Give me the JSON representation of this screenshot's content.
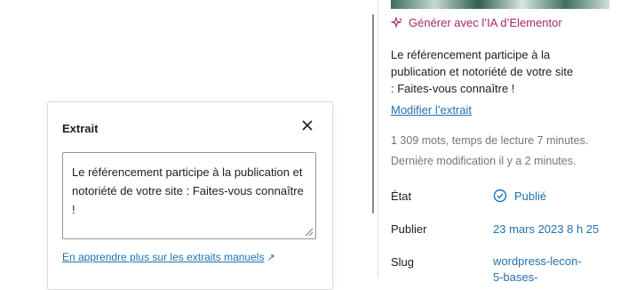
{
  "popover": {
    "title": "Extrait",
    "excerpt_text": "Le référencement participe à la publication et notoriété de votre site : Faites-vous connaître !",
    "learn_link": "En apprendre plus sur les extraits manuels"
  },
  "sidebar": {
    "ai_label": "Générer avec l’IA d’Elementor",
    "excerpt_preview": "Le référencement participe à la publication et notoriété de votre site : Faites-vous connaître !",
    "modify_link": "Modifier l’extrait",
    "word_count": "1 309 mots, temps de lecture 7 minutes.",
    "last_modified": "Dernière modification il y a 2 minutes.",
    "status_label": "État",
    "status_value": "Publié",
    "publish_label": "Publier",
    "publish_value": "23 mars 2023 8 h 25",
    "slug_label": "Slug",
    "slug_value": "wordpress-lecon-5-bases-"
  },
  "colors": {
    "link": "#2271b1",
    "ai_accent": "#a4286a",
    "muted_text": "#757575"
  },
  "icons": [
    "close-icon",
    "external-link-icon",
    "sparkle-icon",
    "published-check-icon",
    "resize-grip-icon"
  ]
}
